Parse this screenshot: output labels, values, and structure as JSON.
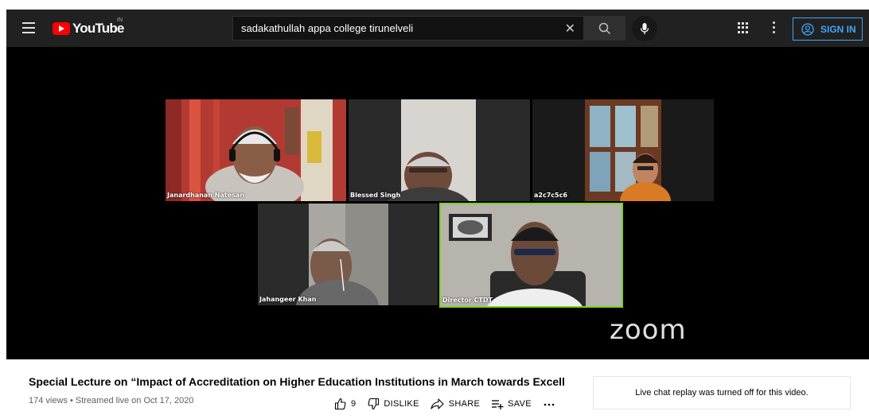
{
  "masthead": {
    "logo_text": "YouTube",
    "country_code": "IN",
    "search_value": "sadakathullah appa college tirunelveli",
    "clear_glyph": "✕",
    "signin_label": "SIGN IN",
    "accent_color": "#3ea6ff"
  },
  "player": {
    "watermark": "zoom",
    "participants": [
      {
        "name": "Janardhanan Natesan"
      },
      {
        "name": "Blessed Singh"
      },
      {
        "name": "a2c7c5c6"
      },
      {
        "name": "Jahangeer Khan"
      },
      {
        "name": "Director CTDT",
        "active_speaker": true
      }
    ],
    "active_border_color": "#7ed321"
  },
  "video": {
    "title": "Special Lecture on “Impact of Accreditation on Higher Education Institutions in March towards Excell",
    "views_line": "174 views • Streamed live on Oct 17, 2020",
    "like_count": "9",
    "dislike_label": "DISLIKE",
    "share_label": "SHARE",
    "save_label": "SAVE"
  },
  "chat": {
    "message": "Live chat replay was turned off for this video."
  }
}
